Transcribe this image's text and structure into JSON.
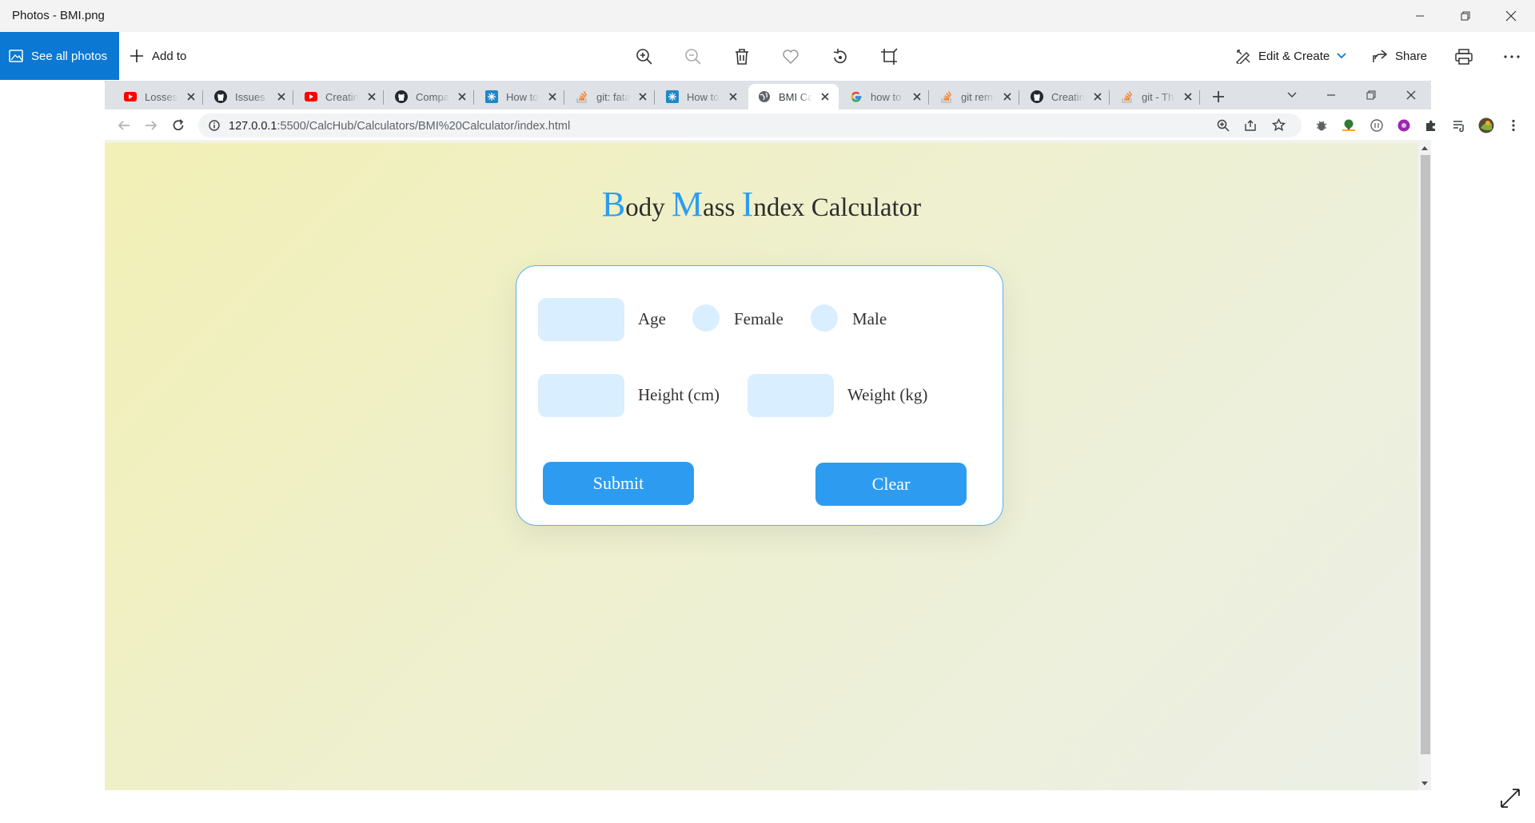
{
  "app": {
    "title": "Photos - BMI.png",
    "see_all_label": "See all photos",
    "add_to_label": "Add to",
    "edit_create_label": "Edit & Create",
    "share_label": "Share"
  },
  "browser": {
    "tabs": [
      {
        "title": "Losses in",
        "favicon": "youtube-icon"
      },
      {
        "title": "Issues · ",
        "favicon": "github-icon"
      },
      {
        "title": "Creating",
        "favicon": "youtube-icon"
      },
      {
        "title": "Compare",
        "favicon": "github-icon"
      },
      {
        "title": "How to",
        "favicon": "stackedit-icon"
      },
      {
        "title": "git: fatal",
        "favicon": "stackoverflow-icon"
      },
      {
        "title": "How to",
        "favicon": "stackedit-icon"
      },
      {
        "title": "BMI Calc",
        "favicon": "globe-icon",
        "active": true
      },
      {
        "title": "how to",
        "favicon": "google-icon"
      },
      {
        "title": "git remo",
        "favicon": "stackoverflow-icon"
      },
      {
        "title": "Creating",
        "favicon": "github-icon"
      },
      {
        "title": "git - The",
        "favicon": "stackoverflow-icon"
      }
    ],
    "url_host": "127.0.0.1",
    "url_path": ":5500/CalcHub/Calculators/BMI%20Calculator/index.html"
  },
  "page": {
    "title_parts": [
      {
        "cap": "B",
        "rest": "ody "
      },
      {
        "cap": "M",
        "rest": "ass "
      },
      {
        "cap": "I",
        "rest": "ndex Calculator"
      }
    ],
    "form": {
      "age_label": "Age",
      "female_label": "Female",
      "male_label": "Male",
      "height_label": "Height (cm)",
      "weight_label": "Weight (kg)",
      "age_value": "",
      "height_value": "",
      "weight_value": "",
      "submit_label": "Submit",
      "clear_label": "Clear"
    }
  },
  "colors": {
    "accent": "#2d9cf0",
    "field_bg": "#d9eeff",
    "photos_blue": "#0b78d4"
  }
}
